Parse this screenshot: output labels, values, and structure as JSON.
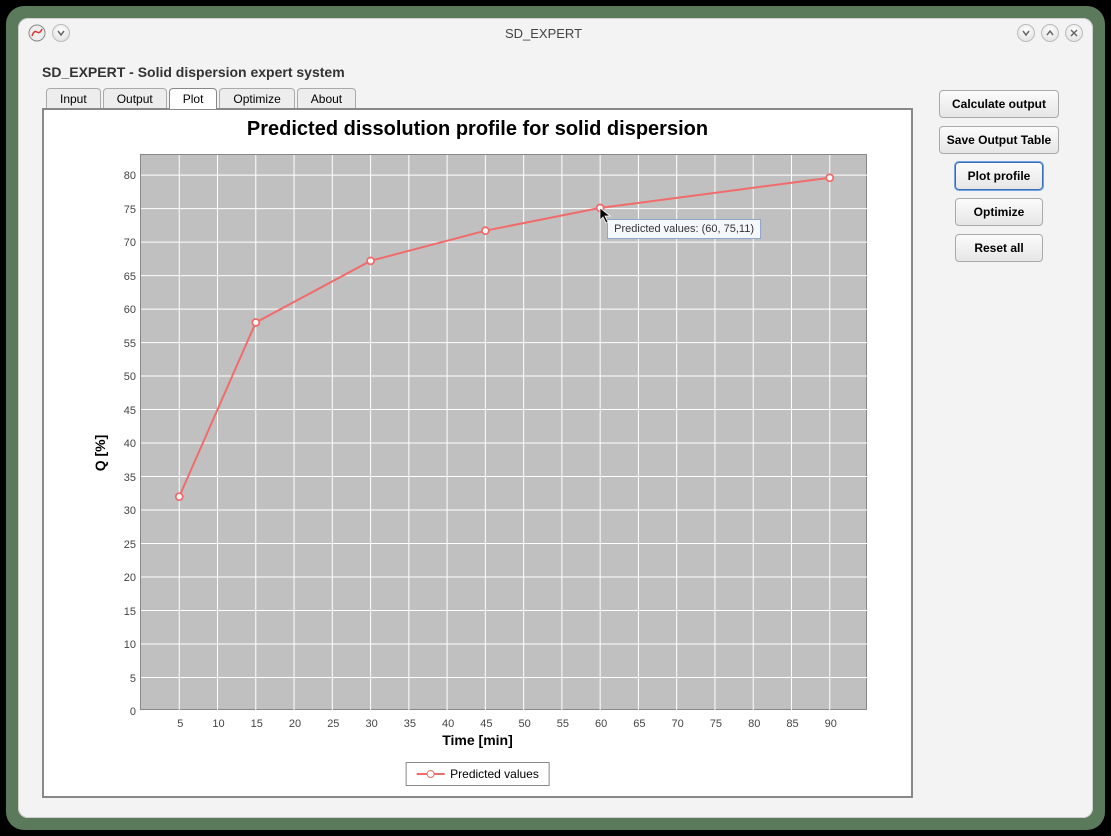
{
  "window": {
    "title": "SD_EXPERT",
    "subtitle": "SD_EXPERT - Solid dispersion expert system"
  },
  "tabs": {
    "items": [
      "Input",
      "Output",
      "Plot",
      "Optimize",
      "About"
    ],
    "active_index": 2
  },
  "buttons": {
    "calculate": "Calculate output",
    "save_table": "Save Output Table",
    "plot_profile": "Plot profile",
    "optimize": "Optimize",
    "reset_all": "Reset all"
  },
  "tooltip": {
    "text": "Predicted values: (60, 75,11)"
  },
  "chart_data": {
    "type": "line",
    "title": "Predicted dissolution profile for solid dispersion",
    "xlabel": "Time [min]",
    "ylabel": "Q [%]",
    "x_ticks": [
      5,
      10,
      15,
      20,
      25,
      30,
      35,
      40,
      45,
      50,
      55,
      60,
      65,
      70,
      75,
      80,
      85,
      90
    ],
    "y_ticks": [
      0,
      5,
      10,
      15,
      20,
      25,
      30,
      35,
      40,
      45,
      50,
      55,
      60,
      65,
      70,
      75,
      80
    ],
    "xlim": [
      0,
      95
    ],
    "ylim": [
      0,
      83
    ],
    "series": [
      {
        "name": "Predicted values",
        "color": "#f26b6b",
        "x": [
          5,
          15,
          30,
          45,
          60,
          90
        ],
        "y": [
          32,
          58,
          67.2,
          71.7,
          75.1,
          79.6
        ]
      }
    ],
    "legend_label": "Predicted values"
  }
}
